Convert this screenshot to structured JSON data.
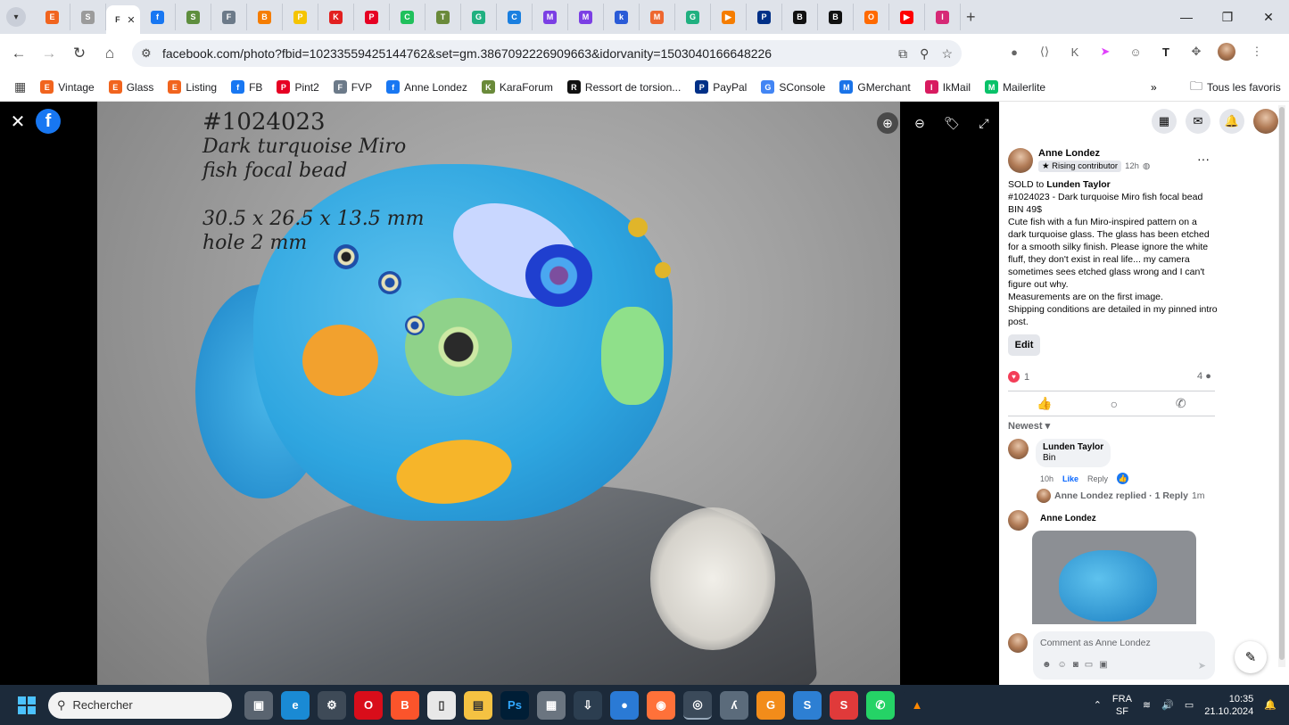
{
  "browser": {
    "tabs": [
      {
        "icon": "etsy-icon",
        "label": "E",
        "color": "#f1641e"
      },
      {
        "icon": "mountain-icon",
        "label": "S",
        "color": "#9b9b9b"
      },
      {
        "icon": "active-tab-icon",
        "label": "F",
        "color": "#ffffff"
      },
      {
        "icon": "facebook-icon",
        "label": "f",
        "color": "#1877f2"
      },
      {
        "icon": "shopify-icon",
        "label": "S",
        "color": "#5e8e3e"
      },
      {
        "icon": "fvp-icon",
        "label": "F",
        "color": "#6c7a89"
      },
      {
        "icon": "blogger-icon",
        "label": "B",
        "color": "#f57d00"
      },
      {
        "icon": "pp-icon",
        "label": "P",
        "color": "#f5c400"
      },
      {
        "icon": "k-icon",
        "label": "K",
        "color": "#e22020"
      },
      {
        "icon": "pinterest-icon",
        "label": "P",
        "color": "#e60023"
      },
      {
        "icon": "chat-icon",
        "label": "C",
        "color": "#20c05c"
      },
      {
        "icon": "turtle-icon",
        "label": "T",
        "color": "#6a8a3a"
      },
      {
        "icon": "grid-icon",
        "label": "G",
        "color": "#20b080"
      },
      {
        "icon": "c-icon",
        "label": "C",
        "color": "#1a7fe0"
      },
      {
        "icon": "heart-message-icon",
        "label": "M",
        "color": "#7b3fe4"
      },
      {
        "icon": "heart-message-icon",
        "label": "M",
        "color": "#7b3fe4"
      },
      {
        "icon": "k-blue-icon",
        "label": "k",
        "color": "#2a5bd7"
      },
      {
        "icon": "magento-icon",
        "label": "M",
        "color": "#ee672f"
      },
      {
        "icon": "grid-green-icon",
        "label": "G",
        "color": "#20b080"
      },
      {
        "icon": "play-icon",
        "label": "▶",
        "color": "#f57d00"
      },
      {
        "icon": "paypal-icon",
        "label": "P",
        "color": "#003087"
      },
      {
        "icon": "box-icon",
        "label": "B",
        "color": "#111111"
      },
      {
        "icon": "box-icon",
        "label": "B",
        "color": "#111111"
      },
      {
        "icon": "orange-icon",
        "label": "O",
        "color": "#ff6a00"
      },
      {
        "icon": "youtube-icon",
        "label": "▶",
        "color": "#ff0000"
      },
      {
        "icon": "instagram-icon",
        "label": "I",
        "color": "#d62976"
      }
    ],
    "active_tab_label": "F",
    "window_controls": {
      "minimize": "—",
      "restore": "❐",
      "close": "✕"
    },
    "url": "facebook.com/photo?fbid=10233559425144762&set=gm.3867092226909663&idorvanity=1503040166648226",
    "bookmarks": [
      {
        "label": "Vintage",
        "icon": "etsy-icon",
        "color": "#f1641e",
        "glyph": "E"
      },
      {
        "label": "Glass",
        "icon": "etsy-icon",
        "color": "#f1641e",
        "glyph": "E"
      },
      {
        "label": "Listing",
        "icon": "etsy-icon",
        "color": "#f1641e",
        "glyph": "E"
      },
      {
        "label": "FB",
        "icon": "facebook-icon",
        "color": "#1877f2",
        "glyph": "f"
      },
      {
        "label": "Pint2",
        "icon": "pinterest-icon",
        "color": "#e60023",
        "glyph": "P"
      },
      {
        "label": "FVP",
        "icon": "fvp-icon",
        "color": "#6c7a89",
        "glyph": "F"
      },
      {
        "label": "Anne Londez",
        "icon": "facebook-icon",
        "color": "#1877f2",
        "glyph": "f"
      },
      {
        "label": "KaraForum",
        "icon": "turtle-icon",
        "color": "#6a8a3a",
        "glyph": "K"
      },
      {
        "label": "Ressort de torsion...",
        "icon": "spring-icon",
        "color": "#111111",
        "glyph": "R"
      },
      {
        "label": "PayPal",
        "icon": "paypal-icon",
        "color": "#003087",
        "glyph": "P"
      },
      {
        "label": "SConsole",
        "icon": "google-icon",
        "color": "#4285f4",
        "glyph": "G"
      },
      {
        "label": "GMerchant",
        "icon": "merchant-icon",
        "color": "#1a73e8",
        "glyph": "M"
      },
      {
        "label": "IkMail",
        "icon": "ikmail-icon",
        "color": "#d81b60",
        "glyph": "I"
      },
      {
        "label": "Mailerlite",
        "icon": "mailerlite-icon",
        "color": "#09c269",
        "glyph": "M"
      }
    ],
    "all_bookmarks": "Tous les favoris"
  },
  "photo": {
    "caption_lines": [
      "#1024023",
      "Dark turquoise Miro",
      "fish focal bead",
      "",
      "30.5 x 26.5 x 13.5 mm",
      "hole 2 mm"
    ]
  },
  "post": {
    "author": "Anne Londez",
    "badge": "Rising contributor",
    "time": "12h",
    "sold_prefix": "SOLD to ",
    "sold_to": "Lunden Taylor",
    "lines": [
      "#1024023 - Dark turquoise Miro fish focal bead",
      "BIN 49$",
      "Cute fish with a fun Miro-inspired pattern on a dark turquoise glass. The glass has been etched for a smooth silky finish. Please ignore the white fluff, they don't exist in real life... my camera sometimes sees etched glass wrong and I can't figure out why.",
      "Measurements are on the first image.",
      "Shipping conditions are detailed in my pinned intro post."
    ],
    "edit_label": "Edit",
    "reaction_count": "1",
    "comment_count": "4",
    "sort_label": "Newest",
    "comment": {
      "author": "Lunden Taylor",
      "text": "Bin",
      "time": "10h",
      "like": "Like",
      "reply": "Reply"
    },
    "replies_text": "Anne Londez replied · 1 Reply",
    "replies_time": "1m",
    "reply_author": "Anne Londez",
    "composer_placeholder": "Comment as Anne Londez"
  },
  "taskbar": {
    "search_placeholder": "Rechercher",
    "lang_top": "FRA",
    "lang_bottom": "SF",
    "time": "10:35",
    "date": "21.10.2024"
  }
}
